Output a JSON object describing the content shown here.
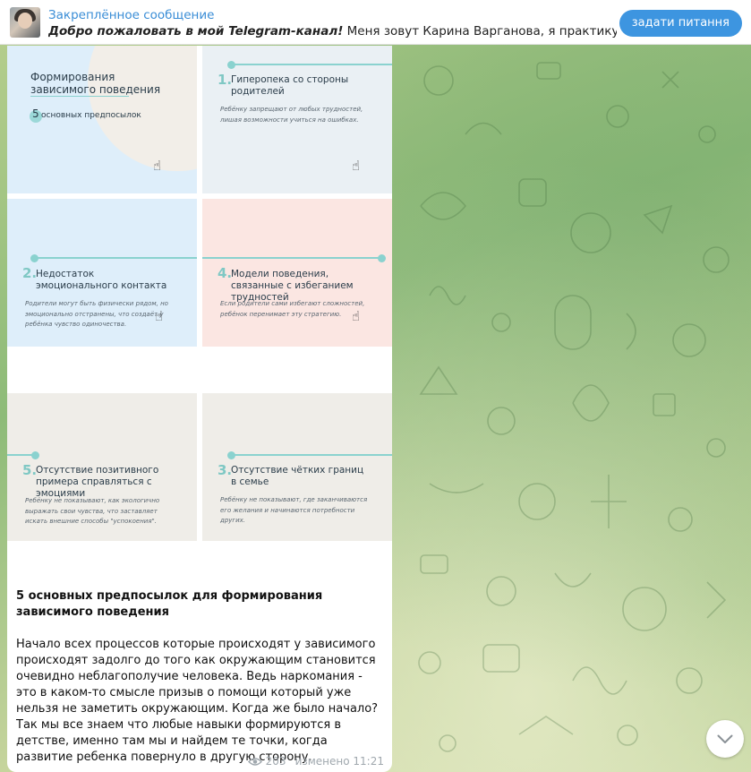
{
  "pinned": {
    "title": "Закреплённое сообщение",
    "text_bold": "Добро пожаловать в мой Telegram-канал!",
    "text_rest": " Меня зовут Карина Варганова, я практикующий психол...",
    "button_label": "задати питання"
  },
  "slides": [
    {
      "number": "",
      "title": "Формирования зависимого поведения",
      "subtitle_num": "5",
      "subtitle": "основных предпосылок",
      "desc": ""
    },
    {
      "number": "1.",
      "title": "Гиперопека со стороны родителей",
      "desc": "Ребёнку запрещают от любых трудностей, лишая возможности учиться на ошибках."
    },
    {
      "number": "2.",
      "title": "Недостаток эмоционального контакта",
      "desc": "Родители могут быть физически рядом, но эмоционально отстранены, что создаёт у ребёнка чувство одиночества."
    },
    {
      "number": "4.",
      "title": "Модели поведения, связанные с избеганием трудностей",
      "desc": "Если родители сами избегают сложностей, ребёнок перенимает эту стратегию."
    },
    {
      "number": "5.",
      "title": "Отсутствие позитивного примера справляться с эмоциями",
      "desc": "Ребёнку не показывают, как экологично выражать свои чувства, что заставляет искать внешние способы \"успокоения\"."
    },
    {
      "number": "3.",
      "title": "Отсутствие чётких границ в семье",
      "desc": "Ребёнку не показывают, где заканчиваются его желания и начинаются потребности других."
    }
  ],
  "message": {
    "title": "5 основных предпосылок для формирования зависимого поведения",
    "body": "Начало всех процессов которые происходят у зависимого происходят задолго до того как окружающим становится очевидно неблагополучие человека. Ведь наркомания - это в каком-то смысле призыв о помощи который уже нельзя не заметить окружающим. Когда же было начало?\nТак мы все знаем что любые навыки формируются в детстве, именно там мы и найдем те точки, когда развитие ребенка повернуло в другую сторону.",
    "views": "203",
    "edited": "изменено 11:21"
  },
  "icons": {
    "views": "eye-icon",
    "swipe": "swipe-hand-icon",
    "scroll": "chevron-down-icon"
  },
  "colors": {
    "accent": "#3d95e0",
    "teal": "#8ad2cf"
  }
}
